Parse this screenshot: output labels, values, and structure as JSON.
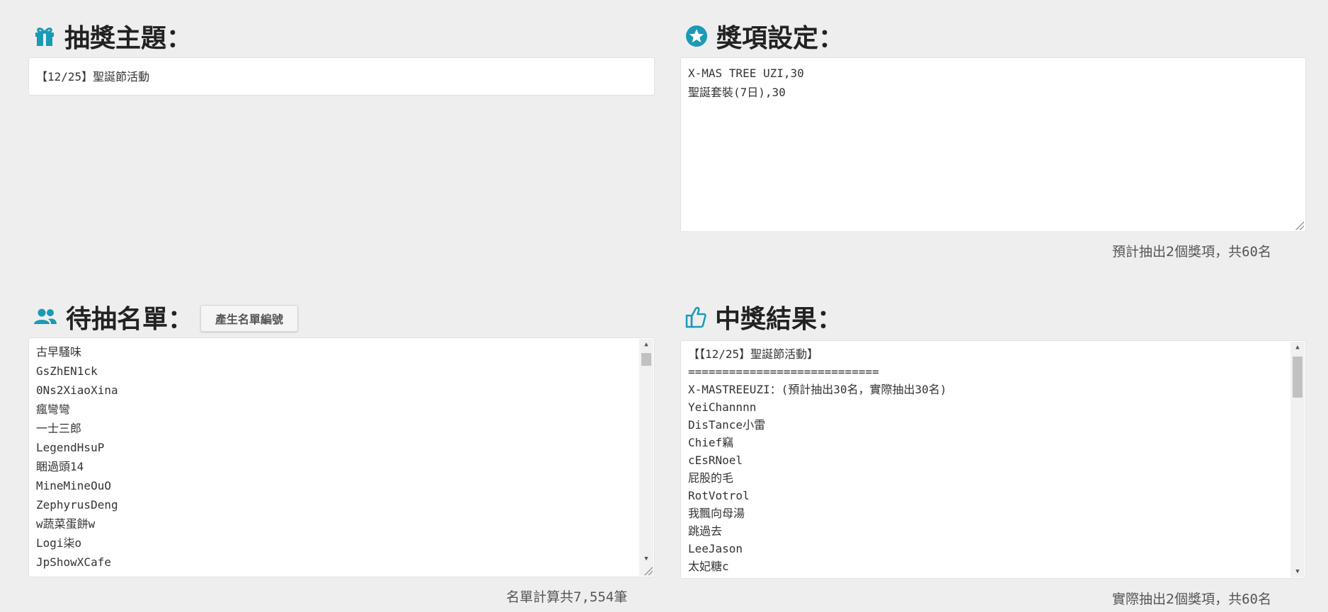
{
  "topic": {
    "heading": "抽獎主題：",
    "value": "【12/25】聖誕節活動"
  },
  "prizes": {
    "heading": "獎項設定：",
    "lines": [
      "X-MAS TREE UZI,30",
      "聖誕套裝(7日),30"
    ],
    "estimate_prefix": "預計抽出2個獎項，共",
    "estimate_count": "60",
    "estimate_suffix": "名"
  },
  "candidates": {
    "heading": "待抽名單：",
    "generate_button": "產生名單編號",
    "lines": [
      "古早騷味",
      "GsZhEN1ck",
      "0Ns2XiaoXina",
      "瘋彎彎",
      "一士三郎",
      "LegendHsuP",
      "睏過頭14",
      "MineMineOuO",
      "ZephyrusDeng",
      "w蔬菜蛋餅w",
      "Logi柒o",
      "JpShowXCafe"
    ],
    "count_prefix": "名單計算共",
    "count_value": "7,554",
    "count_suffix": "筆"
  },
  "results": {
    "heading": "中獎結果：",
    "lines": [
      "【【12/25】聖誕節活動】",
      "============================",
      "X-MASTREEUZI：(預計抽出30名，實際抽出30名)",
      "YeiChannnn",
      "DisTance小雷",
      "Chief竊",
      "cEsRNoel",
      "屁股的毛",
      "RotVotrol",
      "我飄向母湯",
      "跳過去",
      "LeeJason",
      "太妃糖c"
    ],
    "actual_prefix": "實際抽出2個獎項，共",
    "actual_count": "60",
    "actual_suffix": "名"
  },
  "colors": {
    "accent": "#1a9ab5",
    "background": "#eeeeee"
  }
}
